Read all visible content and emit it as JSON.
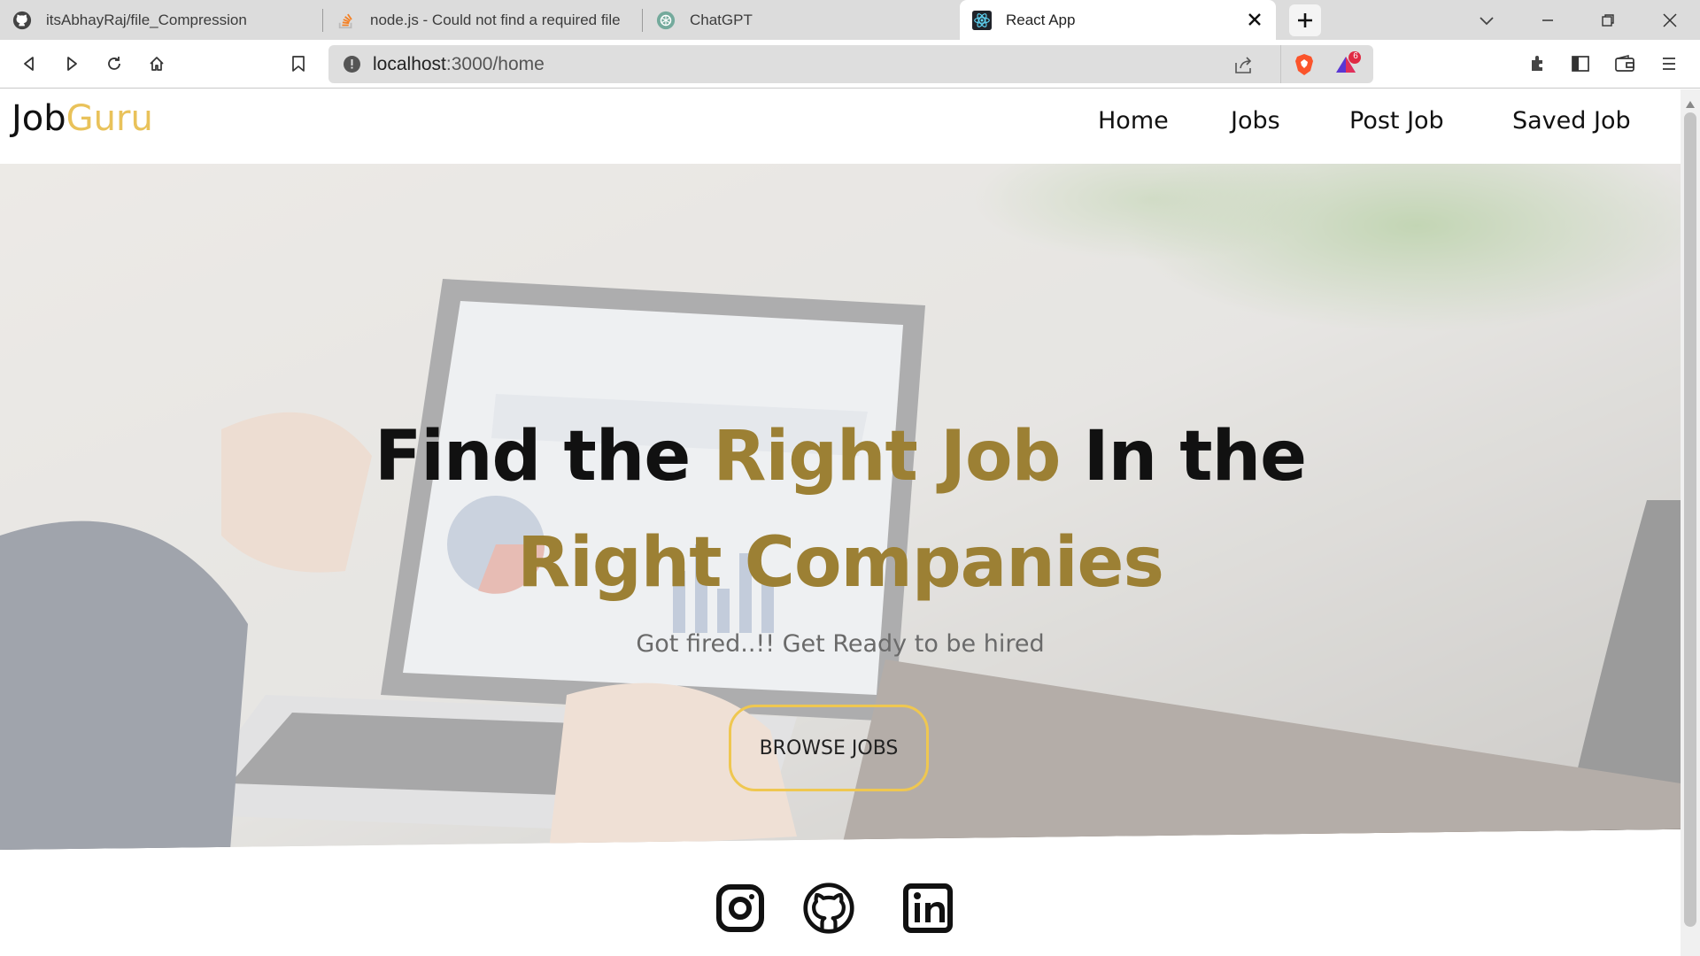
{
  "browser": {
    "tabs": [
      {
        "title": "itsAbhayRaj/file_Compression",
        "icon": "github-icon"
      },
      {
        "title": "node.js - Could not find a required file",
        "icon": "stackoverflow-icon"
      },
      {
        "title": "ChatGPT",
        "icon": "chatgpt-icon"
      },
      {
        "title": "React App",
        "icon": "react-icon",
        "active": true
      }
    ],
    "url_host": "localhost",
    "url_rest": ":3000/home",
    "brave_rewards_badge": "6"
  },
  "site": {
    "brand_main": "Job",
    "brand_accent": "Guru",
    "nav": [
      "Home",
      "Jobs",
      "Post Job",
      "Saved Job"
    ]
  },
  "hero": {
    "line1_part1": "Find the ",
    "line1_gold": "Right Job",
    "line1_part2": " In the",
    "line2_gold": "Right Companies",
    "subtitle": "Got fired..!! Get Ready to be hired",
    "cta": "BROWSE JOBS"
  },
  "footer": {
    "social": [
      "instagram-icon",
      "github-icon",
      "linkedin-icon"
    ]
  },
  "colors": {
    "brand_accent": "#e9c25a",
    "headline_gold": "#9c8034",
    "cta_border": "#efc750"
  }
}
